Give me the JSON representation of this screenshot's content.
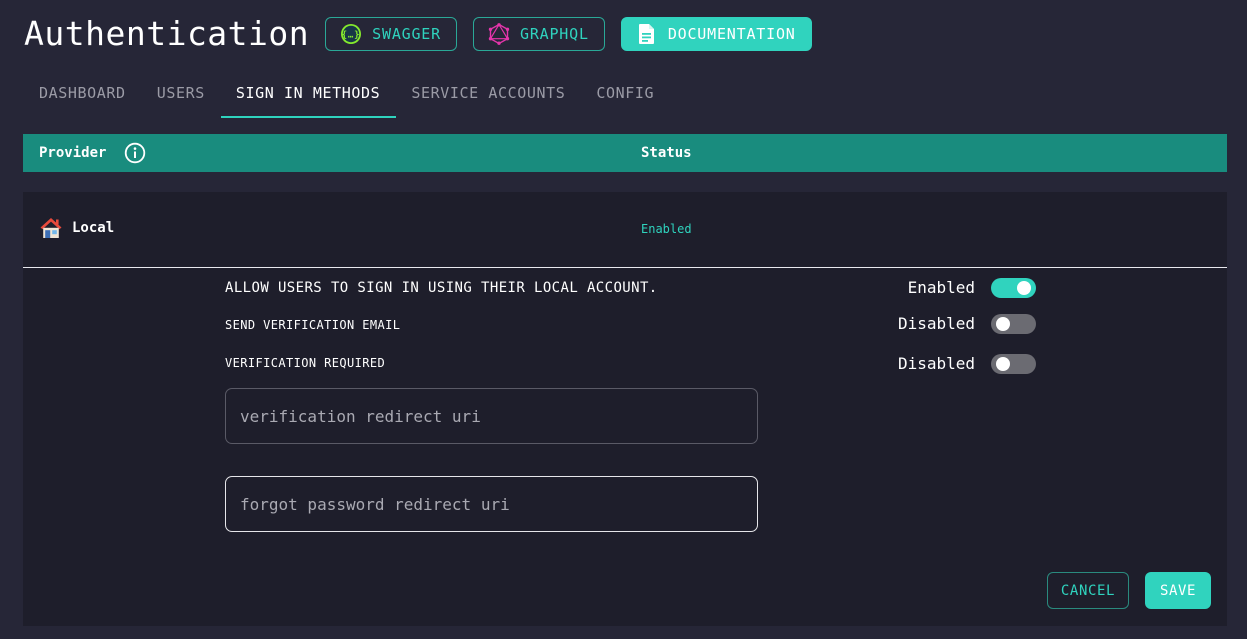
{
  "page": {
    "title": "Authentication"
  },
  "header_buttons": {
    "swagger": {
      "label": "SWAGGER",
      "icon": "swagger-icon"
    },
    "graphql": {
      "label": "GRAPHQL",
      "icon": "graphql-icon"
    },
    "documentation": {
      "label": "DOCUMENTATION",
      "icon": "document-icon"
    }
  },
  "tabs": [
    {
      "label": "DASHBOARD",
      "active": false
    },
    {
      "label": "USERS",
      "active": false
    },
    {
      "label": "SIGN IN METHODS",
      "active": true
    },
    {
      "label": "SERVICE ACCOUNTS",
      "active": false
    },
    {
      "label": "CONFIG",
      "active": false
    }
  ],
  "table": {
    "headers": {
      "provider": "Provider",
      "status": "Status"
    },
    "rows": [
      {
        "provider": "Local",
        "icon": "house-icon",
        "status": "Enabled"
      }
    ]
  },
  "local_settings": {
    "allow_local": {
      "label": "ALLOW USERS TO SIGN IN USING THEIR LOCAL ACCOUNT.",
      "state": "Enabled",
      "on": true
    },
    "send_verification": {
      "label": "SEND VERIFICATION EMAIL",
      "state": "Disabled",
      "on": false
    },
    "verification_required": {
      "label": "VERIFICATION REQUIRED",
      "state": "Disabled",
      "on": false
    },
    "verification_redirect_uri": {
      "placeholder": "verification redirect uri",
      "value": ""
    },
    "forgot_password_redirect_uri": {
      "placeholder": "forgot password redirect uri",
      "value": ""
    }
  },
  "actions": {
    "cancel": "CANCEL",
    "save": "SAVE"
  },
  "colors": {
    "accent": "#30d3be",
    "header_bg": "#198c7e",
    "page_bg": "#262637",
    "panel_bg": "#1e1e2b"
  }
}
